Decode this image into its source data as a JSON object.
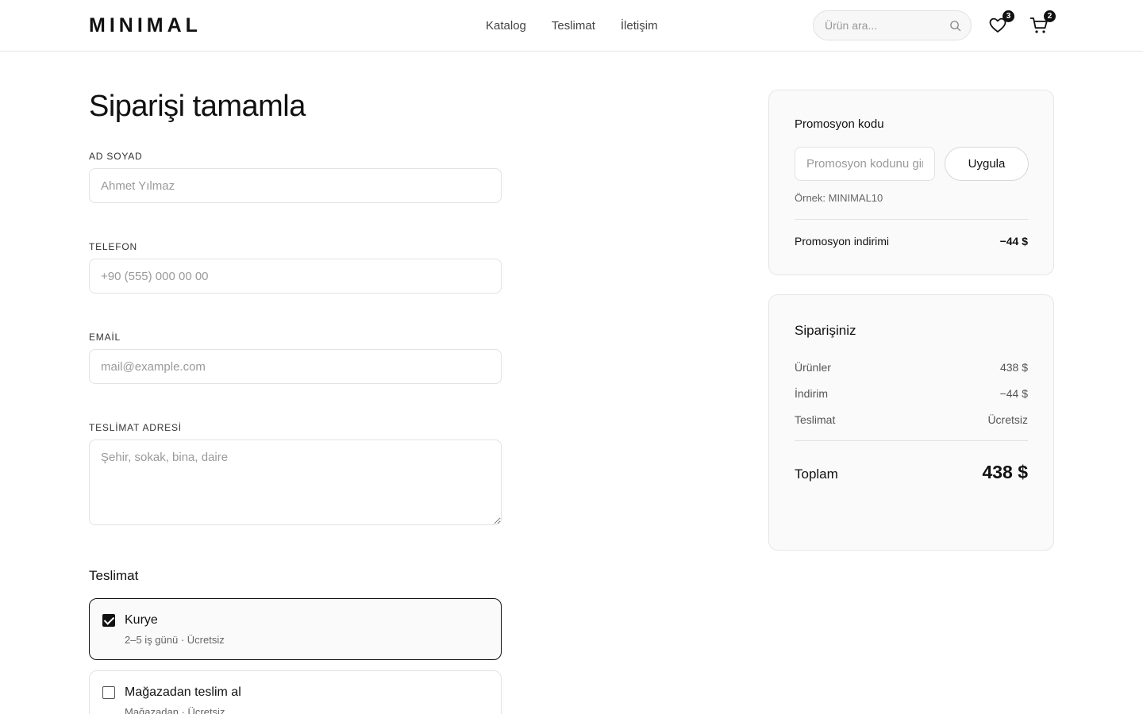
{
  "header": {
    "logo": "MINIMAL",
    "nav": [
      {
        "label": "Katalog"
      },
      {
        "label": "Teslimat"
      },
      {
        "label": "İletişim"
      }
    ],
    "search": {
      "placeholder": "Ürün ara...",
      "icon": "search-icon"
    },
    "wishlist": {
      "icon": "heart-icon",
      "count": "3"
    },
    "cart": {
      "icon": "cart-icon",
      "count": "2"
    }
  },
  "form": {
    "title": "Siparişi tamamla",
    "fields": {
      "name": {
        "label": "AD SOYAD",
        "placeholder": "Ahmet Yılmaz",
        "value": ""
      },
      "phone": {
        "label": "TELEFON",
        "placeholder": "+90 (555) 000 00 00",
        "value": ""
      },
      "email": {
        "label": "EMAİL",
        "placeholder": "mail@example.com",
        "value": ""
      },
      "address": {
        "label": "TESLİMAT ADRESİ",
        "placeholder": "Şehir, sokak, bina, daire",
        "value": ""
      }
    },
    "delivery": {
      "title": "Teslimat",
      "options": [
        {
          "title": "Kurye",
          "subtitle": "2–5 iş günü · Ücretsiz",
          "checked": true
        },
        {
          "title": "Mağazadan teslim al",
          "subtitle": "Mağazadan · Ücretsiz",
          "checked": false
        }
      ]
    }
  },
  "promo": {
    "title": "Promosyon kodu",
    "placeholder": "Promosyon kodunu girin",
    "apply_label": "Uygula",
    "hint": "Örnek: MINIMAL10",
    "discount_label": "Promosyon indirimi",
    "discount_value": "−44 $"
  },
  "summary": {
    "title": "Siparişiniz",
    "rows": [
      {
        "label": "Ürünler",
        "value": "438 $"
      },
      {
        "label": "İndirim",
        "value": "−44 $"
      },
      {
        "label": "Teslimat",
        "value": "Ücretsiz"
      }
    ],
    "total_label": "Toplam",
    "total_value": "438 $"
  },
  "colors": {
    "accent": "#111111",
    "border": "#e2e2e2",
    "card_bg": "#fafafa",
    "muted": "#666666"
  }
}
